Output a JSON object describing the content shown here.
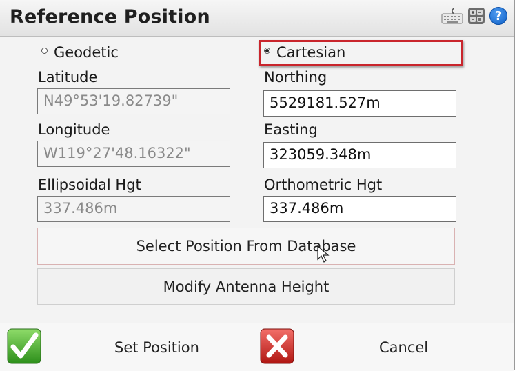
{
  "window": {
    "title": "Reference Position",
    "icons": [
      "keyboard-icon",
      "calculator-icon",
      "help-icon"
    ],
    "help_glyph": "?"
  },
  "mode": {
    "geodetic_label": "Geodetic",
    "cartesian_label": "Cartesian",
    "selected": "Cartesian",
    "highlight_color": "#c9252c"
  },
  "geodetic": {
    "latitude_label": "Latitude",
    "latitude_value": "N49°53'19.82739\"",
    "longitude_label": "Longitude",
    "longitude_value": "W119°27'48.16322\"",
    "ellipsoidal_label": "Ellipsoidal Hgt",
    "ellipsoidal_value": "337.486m"
  },
  "cartesian": {
    "northing_label": "Northing",
    "northing_value": "5529181.527m",
    "easting_label": "Easting",
    "easting_value": "323059.348m",
    "orthometric_label": "Orthometric Hgt",
    "orthometric_value": "337.486m"
  },
  "actions": {
    "select_db_label": "Select Position From Database",
    "modify_antenna_label": "Modify Antenna Height"
  },
  "footer": {
    "set_position_label": "Set Position",
    "cancel_label": "Cancel",
    "ok_color": "#3fae2a",
    "cancel_color": "#d2261f"
  }
}
